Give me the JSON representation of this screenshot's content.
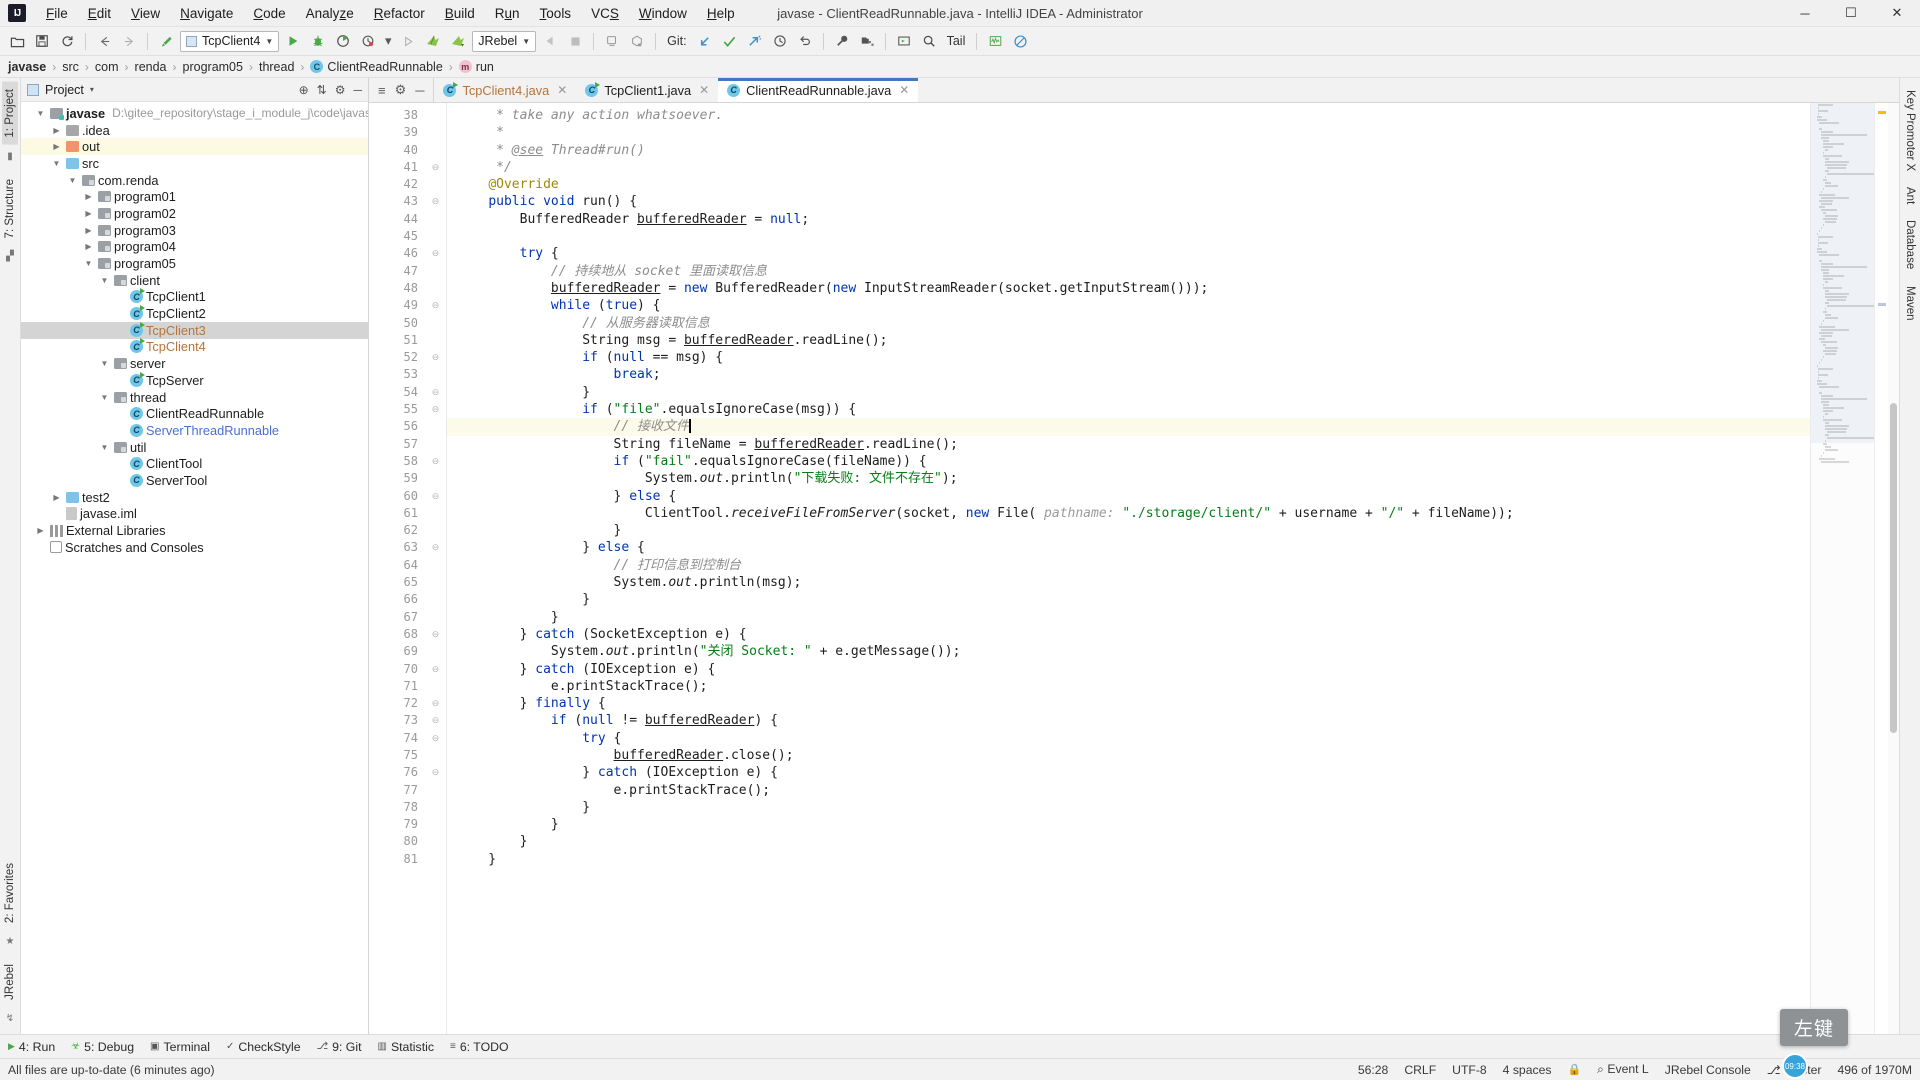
{
  "window": {
    "title": "javase - ClientReadRunnable.java - IntelliJ IDEA - Administrator",
    "logo": "IJ",
    "minimize": "─",
    "maximize": "☐",
    "close": "✕"
  },
  "menubar": {
    "items": [
      {
        "label": "File",
        "name": "menu-file"
      },
      {
        "label": "Edit",
        "name": "menu-edit"
      },
      {
        "label": "View",
        "name": "menu-view"
      },
      {
        "label": "Navigate",
        "name": "menu-navigate"
      },
      {
        "label": "Code",
        "name": "menu-code"
      },
      {
        "label": "Analyze",
        "name": "menu-analyze"
      },
      {
        "label": "Refactor",
        "name": "menu-refactor"
      },
      {
        "label": "Build",
        "name": "menu-build"
      },
      {
        "label": "Run",
        "name": "menu-run"
      },
      {
        "label": "Tools",
        "name": "menu-tools"
      },
      {
        "label": "VCS",
        "name": "menu-vcs"
      },
      {
        "label": "Window",
        "name": "menu-window"
      },
      {
        "label": "Help",
        "name": "menu-help"
      }
    ]
  },
  "toolbar": {
    "open_icon": "📂",
    "save_icon": "💾",
    "sync_icon": "⟳",
    "back_icon": "←",
    "forward_icon": "→",
    "build_icon": "⤵",
    "run_config": "TcpClient4",
    "run_icon": "▶",
    "debug_icon": "☣",
    "coverage_icon": "◑",
    "profile_icon": "◴",
    "profile_caret": "▾",
    "rerun_icon": "▷",
    "jrebel_run_icon": "➤",
    "jrebel_debug_icon": "➤",
    "jrebel_config": "JRebel",
    "stop_back_icon": "◀",
    "stop_icon": "■",
    "avd_icon": "▭",
    "sdk_icon": "⛁",
    "git_label": "Git:",
    "update_icon": "↙",
    "commit_icon": "✔",
    "push_icon": "↗",
    "history_icon": "◷",
    "revert_icon": "↶",
    "settings_icon": "🔧",
    "project_struct_icon": "▤",
    "run_anything_icon": "▷",
    "search_icon": "🔍",
    "tail_label": "Tail",
    "monitor_icon": "〰",
    "disable_icon": "⊘"
  },
  "breadcrumb": {
    "items": [
      {
        "label": "javase",
        "bold": true,
        "icon": ""
      },
      {
        "label": "src",
        "bold": false,
        "icon": ""
      },
      {
        "label": "com",
        "bold": false,
        "icon": ""
      },
      {
        "label": "renda",
        "bold": false,
        "icon": ""
      },
      {
        "label": "program05",
        "bold": false,
        "icon": ""
      },
      {
        "label": "thread",
        "bold": false,
        "icon": ""
      },
      {
        "label": "ClientReadRunnable",
        "bold": false,
        "icon": "class"
      },
      {
        "label": "run",
        "bold": false,
        "icon": "method"
      }
    ],
    "separator": "›",
    "class_glyph": "C",
    "method_glyph": "m"
  },
  "left_rail": {
    "project": "1: Project",
    "structure": "7: Structure",
    "favorites": "2: Favorites",
    "jrebel": "JRebel",
    "star_icon": "★"
  },
  "right_rail": {
    "key_promoter": "Key Promoter X",
    "ant": "Ant",
    "database": "Database",
    "maven": "Maven"
  },
  "project_panel": {
    "title": "Project",
    "caret": "▾",
    "actions": [
      "⊕",
      "⇅",
      "⚙",
      "─"
    ],
    "tree": [
      {
        "indent": 0,
        "arrow": "▼",
        "icon": "folder-module",
        "label": "javase",
        "bold": true,
        "sub": "D:\\gitee_repository\\stage_i_module_j\\code\\javase",
        "name": "tree-node-javase"
      },
      {
        "indent": 1,
        "arrow": "▶",
        "icon": "folder-gray",
        "label": ".idea",
        "name": "tree-node-idea"
      },
      {
        "indent": 1,
        "arrow": "▶",
        "icon": "folder-orange",
        "label": "out",
        "highlight": true,
        "name": "tree-node-out"
      },
      {
        "indent": 1,
        "arrow": "▼",
        "icon": "folder-blue",
        "label": "src",
        "name": "tree-node-src"
      },
      {
        "indent": 2,
        "arrow": "▼",
        "icon": "package",
        "label": "com.renda",
        "name": "tree-node-com-renda"
      },
      {
        "indent": 3,
        "arrow": "▶",
        "icon": "package",
        "label": "program01",
        "name": "tree-node-program01"
      },
      {
        "indent": 3,
        "arrow": "▶",
        "icon": "package",
        "label": "program02",
        "name": "tree-node-program02"
      },
      {
        "indent": 3,
        "arrow": "▶",
        "icon": "package",
        "label": "program03",
        "name": "tree-node-program03"
      },
      {
        "indent": 3,
        "arrow": "▶",
        "icon": "package",
        "label": "program04",
        "name": "tree-node-program04"
      },
      {
        "indent": 3,
        "arrow": "▼",
        "icon": "package",
        "label": "program05",
        "name": "tree-node-program05"
      },
      {
        "indent": 4,
        "arrow": "▼",
        "icon": "package",
        "label": "client",
        "name": "tree-node-client"
      },
      {
        "indent": 5,
        "arrow": "",
        "icon": "class-runnable",
        "label": "TcpClient1",
        "name": "tree-node-tcpclient1"
      },
      {
        "indent": 5,
        "arrow": "",
        "icon": "class-runnable",
        "label": "TcpClient2",
        "name": "tree-node-tcpclient2"
      },
      {
        "indent": 5,
        "arrow": "",
        "icon": "class-runnable",
        "label": "TcpClient3",
        "color": "modified",
        "selected": true,
        "name": "tree-node-tcpclient3"
      },
      {
        "indent": 5,
        "arrow": "",
        "icon": "class-runnable",
        "label": "TcpClient4",
        "color": "modified",
        "name": "tree-node-tcpclient4"
      },
      {
        "indent": 4,
        "arrow": "▼",
        "icon": "package",
        "label": "server",
        "name": "tree-node-server"
      },
      {
        "indent": 5,
        "arrow": "",
        "icon": "class-runnable",
        "label": "TcpServer",
        "name": "tree-node-tcpserver"
      },
      {
        "indent": 4,
        "arrow": "▼",
        "icon": "package",
        "label": "thread",
        "name": "tree-node-thread"
      },
      {
        "indent": 5,
        "arrow": "",
        "icon": "class",
        "label": "ClientReadRunnable",
        "name": "tree-node-clientreadrunnable"
      },
      {
        "indent": 5,
        "arrow": "",
        "icon": "class",
        "label": "ServerThreadRunnable",
        "color": "blue",
        "name": "tree-node-serverthreadrunnable"
      },
      {
        "indent": 4,
        "arrow": "▼",
        "icon": "package",
        "label": "util",
        "name": "tree-node-util"
      },
      {
        "indent": 5,
        "arrow": "",
        "icon": "class",
        "label": "ClientTool",
        "name": "tree-node-clienttool"
      },
      {
        "indent": 5,
        "arrow": "",
        "icon": "class",
        "label": "ServerTool",
        "name": "tree-node-servertool"
      },
      {
        "indent": 1,
        "arrow": "▶",
        "icon": "folder-blue",
        "label": "test2",
        "name": "tree-node-test2"
      },
      {
        "indent": 1,
        "arrow": "",
        "icon": "file",
        "label": "javase.iml",
        "name": "tree-node-javase-iml"
      },
      {
        "indent": 0,
        "arrow": "▶",
        "icon": "lib",
        "label": "External Libraries",
        "name": "tree-node-external-libraries"
      },
      {
        "indent": 0,
        "arrow": "",
        "icon": "scratch",
        "label": "Scratches and Consoles",
        "name": "tree-node-scratches"
      }
    ]
  },
  "editor": {
    "tab_actions": [
      "≡",
      "⚙",
      "─"
    ],
    "tabs": [
      {
        "label": "TcpClient4.java",
        "icon": "class-runnable",
        "modified": true,
        "active": false,
        "close": "✕",
        "name": "tab-tcpclient4"
      },
      {
        "label": "TcpClient1.java",
        "icon": "class-runnable",
        "modified": false,
        "active": false,
        "close": "✕",
        "name": "tab-tcpclient1"
      },
      {
        "label": "ClientReadRunnable.java",
        "icon": "class",
        "modified": false,
        "active": true,
        "close": "✕",
        "name": "tab-clientreadrunnable"
      }
    ],
    "first_line": 38,
    "lines": [
      {
        "n": 38,
        "fold": "",
        "html": "     <span class='doc'>* take any action whatsoever.</span>"
      },
      {
        "n": 39,
        "fold": "",
        "html": "     <span class='doc'>*</span>"
      },
      {
        "n": 40,
        "fold": "",
        "html": "     <span class='doc'>* </span><span class='doctag'>@see</span><span class='doc'> Thread#run()</span>"
      },
      {
        "n": 41,
        "fold": "⊖",
        "html": "     <span class='doc'>*/</span>"
      },
      {
        "n": 42,
        "fold": "",
        "html": "    <span class='anno'>@Override</span>"
      },
      {
        "n": 43,
        "fold": "⊖",
        "gutterMark": "impl",
        "html": "    <span class='kw'>public void</span> run() {"
      },
      {
        "n": 44,
        "fold": "",
        "html": "        BufferedReader <span class='fld'>bufferedReader</span> = <span class='kw'>null</span>;"
      },
      {
        "n": 45,
        "fold": "",
        "html": ""
      },
      {
        "n": 46,
        "fold": "⊖",
        "html": "        <span class='kw'>try</span> {"
      },
      {
        "n": 47,
        "fold": "",
        "html": "            <span class='cmt'>// 持续地从 socket 里面读取信息</span>"
      },
      {
        "n": 48,
        "fold": "",
        "html": "            <span class='fld'>bufferedReader</span> = <span class='kw'>new</span> BufferedReader(<span class='kw'>new</span> InputStreamReader(socket.getInputStream()));"
      },
      {
        "n": 49,
        "fold": "⊖",
        "html": "            <span class='kw'>while</span> (<span class='kw'>true</span>) {"
      },
      {
        "n": 50,
        "fold": "",
        "html": "                <span class='cmt'>// 从服务器读取信息</span>"
      },
      {
        "n": 51,
        "fold": "",
        "html": "                String msg = <span class='fld'>bufferedReader</span>.readLine();"
      },
      {
        "n": 52,
        "fold": "⊖",
        "html": "                <span class='kw'>if</span> (<span class='kw'>null</span> == msg) {"
      },
      {
        "n": 53,
        "fold": "",
        "html": "                    <span class='kw'>break</span>;"
      },
      {
        "n": 54,
        "fold": "⊖",
        "html": "                }"
      },
      {
        "n": 55,
        "fold": "⊖",
        "html": "                <span class='kw'>if</span> (<span class='str'>\"file\"</span>.equalsIgnoreCase(msg)) {"
      },
      {
        "n": 56,
        "fold": "",
        "current": true,
        "html": "                    <span class='cmt'>// 接收文件</span><span class='caret-bar'></span>"
      },
      {
        "n": 57,
        "fold": "",
        "html": "                    String fileName = <span class='fld'>bufferedReader</span>.readLine();"
      },
      {
        "n": 58,
        "fold": "⊖",
        "html": "                    <span class='kw'>if</span> (<span class='str'>\"fail\"</span>.equalsIgnoreCase(fileName)) {"
      },
      {
        "n": 59,
        "fold": "",
        "html": "                        System.<span class='stat'>out</span>.println(<span class='str'>\"下载失败: 文件不存在\"</span>);"
      },
      {
        "n": 60,
        "fold": "⊖",
        "html": "                    } <span class='kw'>else</span> {"
      },
      {
        "n": 61,
        "fold": "",
        "html": "                        ClientTool.<span class='stat'>receiveFileFromServer</span>(socket, <span class='kw'>new</span> File( <span class='hint'>pathname:</span> <span class='str'>\"./storage/client/\"</span> + username + <span class='str'>\"/\"</span> + fileName));"
      },
      {
        "n": 62,
        "fold": "",
        "html": "                    }"
      },
      {
        "n": 63,
        "fold": "⊖",
        "html": "                } <span class='kw'>else</span> {"
      },
      {
        "n": 64,
        "fold": "",
        "html": "                    <span class='cmt'>// 打印信息到控制台</span>"
      },
      {
        "n": 65,
        "fold": "",
        "html": "                    System.<span class='stat'>out</span>.println(msg);"
      },
      {
        "n": 66,
        "fold": "",
        "html": "                }"
      },
      {
        "n": 67,
        "fold": "",
        "html": "            }"
      },
      {
        "n": 68,
        "fold": "⊖",
        "html": "        } <span class='kw'>catch</span> (SocketException e) {"
      },
      {
        "n": 69,
        "fold": "",
        "html": "            System.<span class='stat'>out</span>.println(<span class='str'>\"关闭 Socket: \"</span> + e.getMessage());"
      },
      {
        "n": 70,
        "fold": "⊖",
        "html": "        } <span class='kw'>catch</span> (IOException e) {"
      },
      {
        "n": 71,
        "fold": "",
        "html": "            e.printStackTrace();"
      },
      {
        "n": 72,
        "fold": "⊖",
        "html": "        } <span class='kw'>finally</span> {"
      },
      {
        "n": 73,
        "fold": "⊖",
        "html": "            <span class='kw'>if</span> (<span class='kw'>null</span> != <span class='fld'>bufferedReader</span>) {"
      },
      {
        "n": 74,
        "fold": "⊖",
        "html": "                <span class='kw'>try</span> {"
      },
      {
        "n": 75,
        "fold": "",
        "html": "                    <span class='fld'>bufferedReader</span>.close();"
      },
      {
        "n": 76,
        "fold": "⊖",
        "html": "                } <span class='kw'>catch</span> (IOException e) {"
      },
      {
        "n": 77,
        "fold": "",
        "html": "                    e.printStackTrace();"
      },
      {
        "n": 78,
        "fold": "",
        "html": "                }"
      },
      {
        "n": 79,
        "fold": "",
        "html": "            }"
      },
      {
        "n": 80,
        "fold": "",
        "html": "        }"
      },
      {
        "n": 81,
        "fold": "",
        "html": "    }"
      }
    ]
  },
  "bottom_toolwindows": [
    {
      "label": "4: Run",
      "icon": "▶",
      "name": "toolwindow-run"
    },
    {
      "label": "5: Debug",
      "icon": "☣",
      "name": "toolwindow-debug"
    },
    {
      "label": "Terminal",
      "icon": "▣",
      "name": "toolwindow-terminal"
    },
    {
      "label": "CheckStyle",
      "icon": "✓",
      "name": "toolwindow-checkstyle"
    },
    {
      "label": "9: Git",
      "icon": "⎇",
      "name": "toolwindow-git"
    },
    {
      "label": "Statistic",
      "icon": "▥",
      "name": "toolwindow-statistic"
    },
    {
      "label": "6: TODO",
      "icon": "≡",
      "name": "toolwindow-todo"
    }
  ],
  "statusbar": {
    "message": "All files are up-to-date (6 minutes ago)",
    "caret_position": "56:28",
    "line_separator": "CRLF",
    "encoding": "UTF-8",
    "indent": "4 spaces",
    "event_log": "Event L",
    "event_log_icon": "⌕",
    "jrebel_console": "JRebel Console",
    "branch": "master",
    "branch_icon": "⎇",
    "memory": "496 of 1970M",
    "lock_icon": "🔒"
  },
  "overlay": {
    "key_hint": "左键",
    "clock": "09:38"
  },
  "colors": {
    "accent": "#4477bb",
    "keyword": "#0033b3",
    "string": "#067d17",
    "comment": "#8c8c8c",
    "annotation": "#9e880d",
    "modified_file": "#b5743a",
    "selection": "#d4d4d4",
    "current_line": "#fcfae8"
  }
}
